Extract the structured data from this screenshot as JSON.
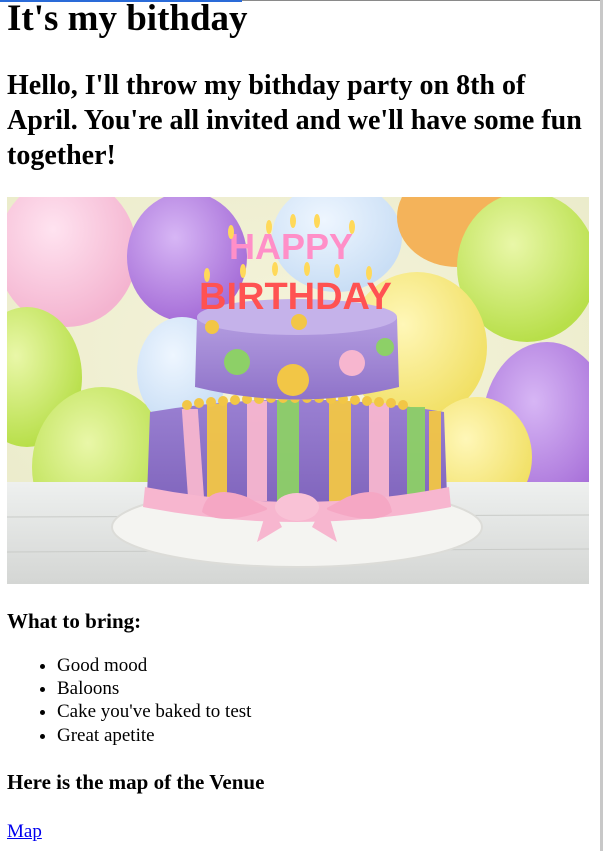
{
  "page": {
    "title": "It's my bithday",
    "intro": "Hello, I'll throw my bithday party on 8th of April. You're all invited and we'll have some fun together!"
  },
  "hero_image": {
    "description_icon": "birthday-cake-image",
    "candle_text_top": "HAPPY",
    "candle_text_bottom": "BIRTHDAY",
    "colors": {
      "cake_purple": "#a58ad8",
      "stripe_yellow": "#f2c646",
      "stripe_green": "#8dd067",
      "bow_pink": "#f7b6cf"
    }
  },
  "bring": {
    "heading": "What to bring:",
    "items": [
      "Good mood",
      "Baloons",
      "Cake you've baked to test",
      "Great apetite"
    ]
  },
  "venue": {
    "heading": "Here is the map of the Venue",
    "link_label": "Map",
    "link_color": "#0000ee"
  }
}
